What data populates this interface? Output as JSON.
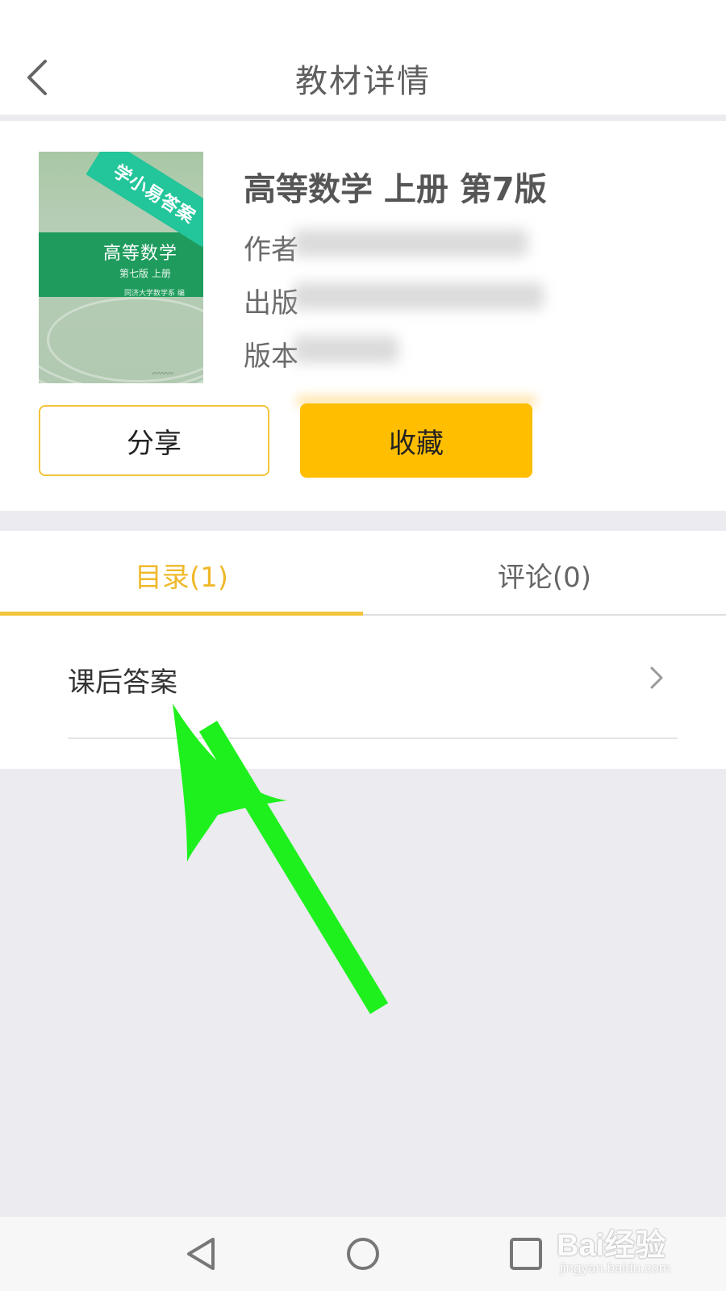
{
  "header": {
    "title": "教材详情",
    "back_icon": "chevron-left-icon"
  },
  "book": {
    "title": "高等数学 上册 第7版",
    "cover": {
      "ribbon_text": "学小易答案",
      "title": "高等数学",
      "edition": "第七版 上册",
      "authors": "同济大学数学系 编"
    },
    "meta": {
      "author_label": "作者",
      "publisher_label": "出版",
      "edition_label": "版本"
    }
  },
  "actions": {
    "share_label": "分享",
    "favorite_label": "收藏"
  },
  "tabs": [
    {
      "label": "目录(1)",
      "active": true
    },
    {
      "label": "评论(0)",
      "active": false
    }
  ],
  "catalog": {
    "items": [
      {
        "label": "课后答案"
      }
    ]
  },
  "navbar": {
    "back_icon": "triangle-back-icon",
    "home_icon": "circle-home-icon",
    "recents_icon": "square-recents-icon"
  },
  "watermark": {
    "text": "Bai经验",
    "sub": "jingyan.baidu.com"
  },
  "colors": {
    "accent": "#ffbe00",
    "tab_active": "#f0b92b",
    "background": "#ebebf0",
    "annotation_arrow": "#1ef01e"
  }
}
